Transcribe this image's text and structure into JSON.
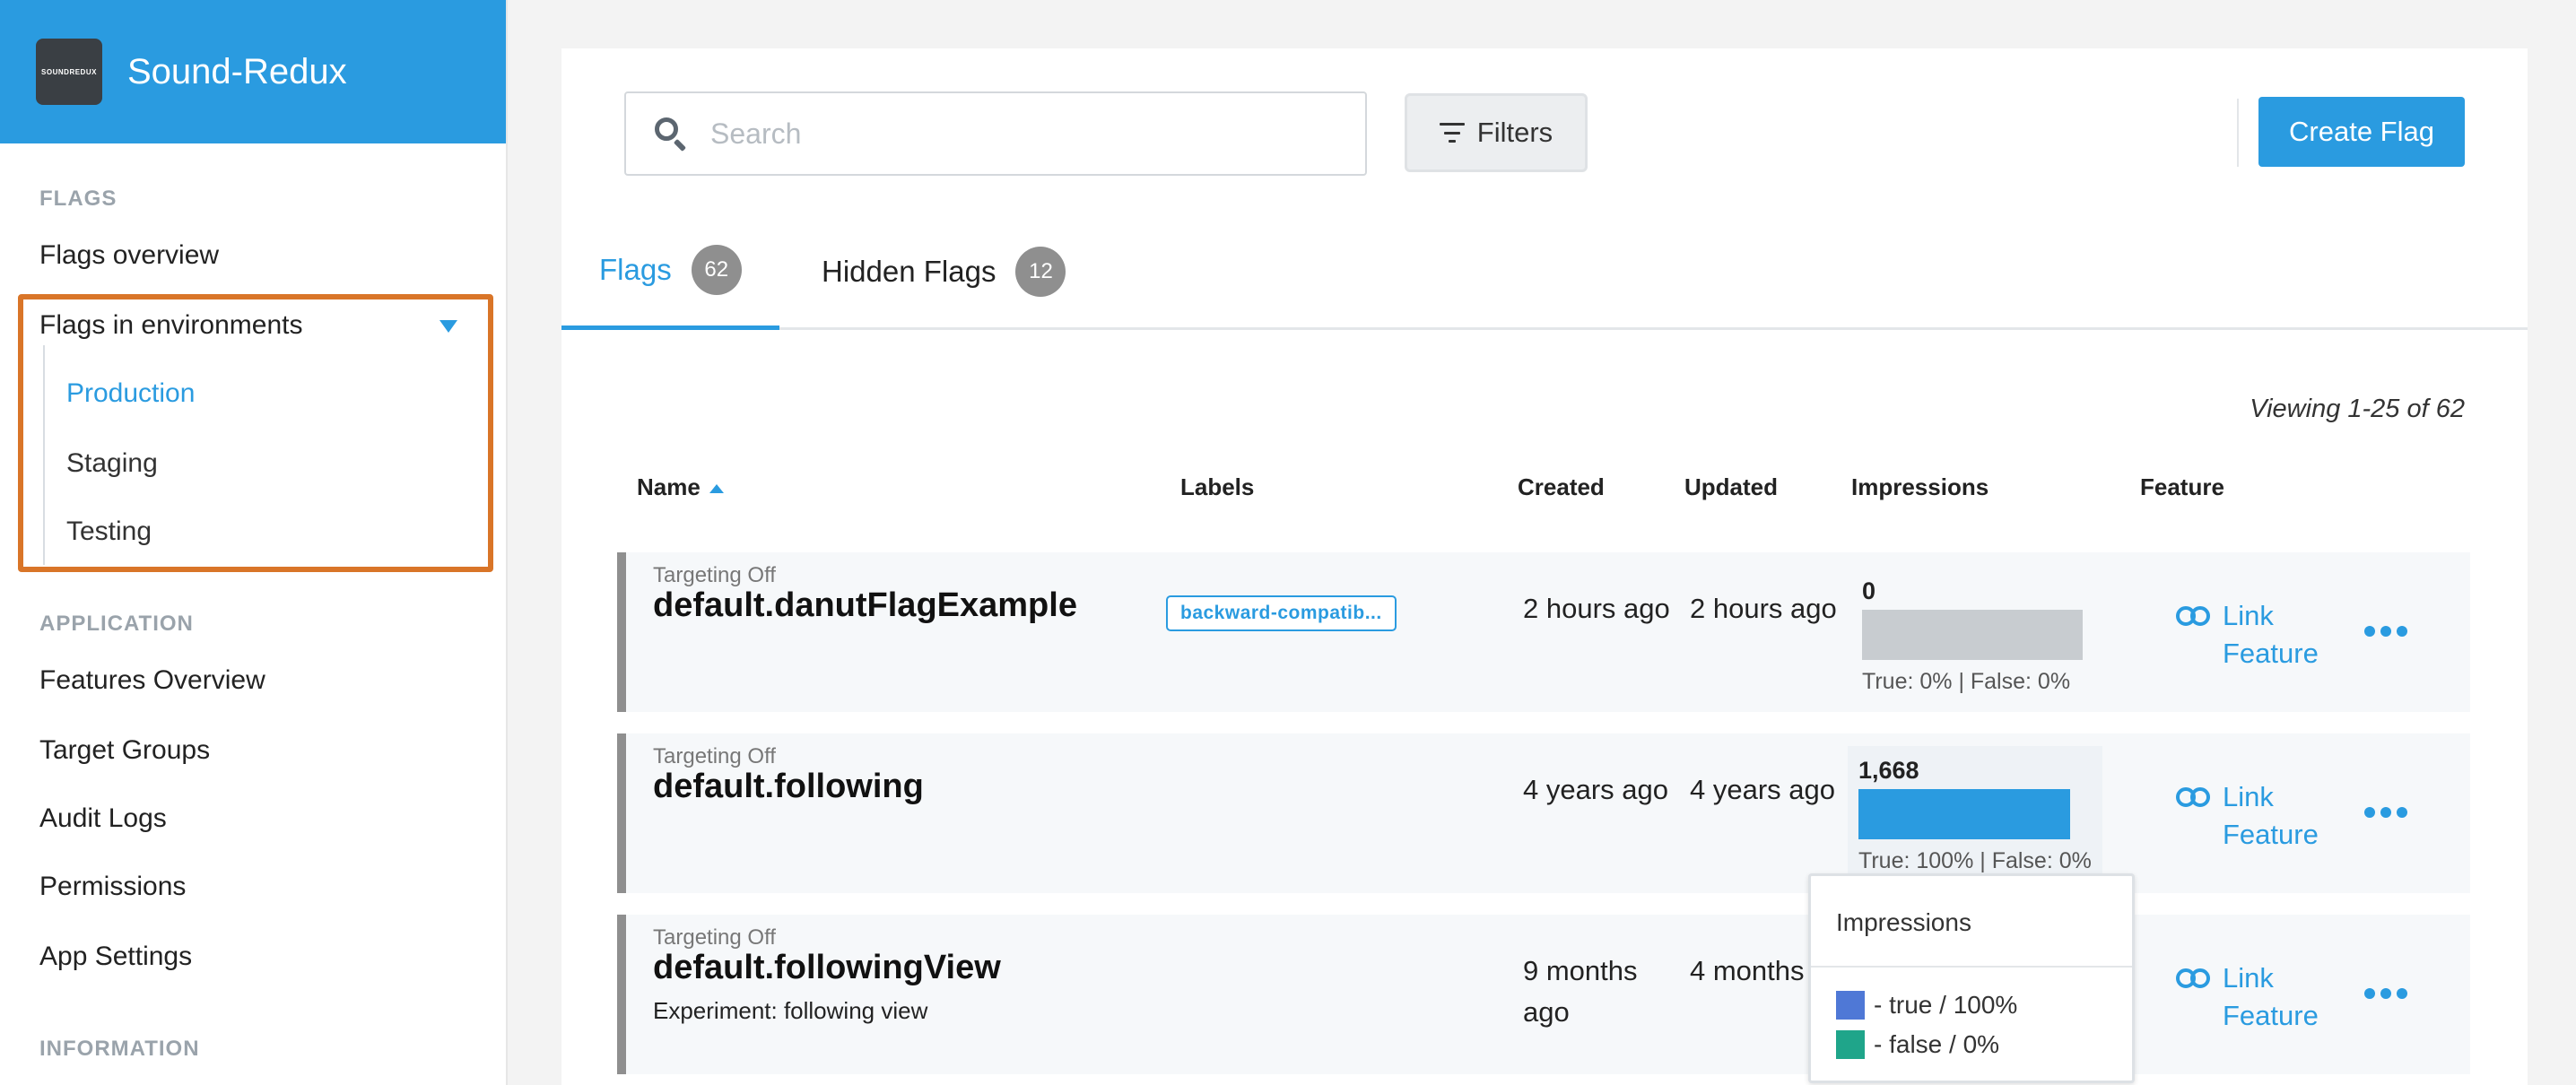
{
  "brand": {
    "logo_text": "SOUNDREDUX",
    "name": "Sound-Redux"
  },
  "sidebar": {
    "flags_label": "FLAGS",
    "flags_overview": "Flags overview",
    "flags_in_env": "Flags in environments",
    "environments": [
      "Production",
      "Staging",
      "Testing"
    ],
    "application_label": "APPLICATION",
    "app_items": [
      "Features Overview",
      "Target Groups",
      "Audit Logs",
      "Permissions",
      "App Settings"
    ],
    "information_label": "INFORMATION"
  },
  "search": {
    "placeholder": "Search"
  },
  "toolbar": {
    "filters_label": "Filters",
    "create_label": "Create Flag"
  },
  "tabs": [
    {
      "label": "Flags",
      "count": "62"
    },
    {
      "label": "Hidden Flags",
      "count": "12"
    }
  ],
  "viewing": "Viewing 1-25 of 62",
  "table": {
    "headers": {
      "name": "Name",
      "labels": "Labels",
      "created": "Created",
      "updated": "Updated",
      "impressions": "Impressions",
      "feature": "Feature"
    },
    "rows": [
      {
        "status": "Targeting Off",
        "name": "default.danutFlagExample",
        "description": "",
        "label": "backward-compatib...",
        "created": "2 hours ago",
        "updated": "2 hours ago",
        "impressions": "0",
        "impressions_true_fraction": 0,
        "impressions_sub": "True: 0% | False: 0%",
        "feature": "Link Feature"
      },
      {
        "status": "Targeting Off",
        "name": "default.following",
        "description": "",
        "label": "",
        "created": "4 years ago",
        "updated": "4 years ago",
        "impressions": "1,668",
        "impressions_true_fraction": 1,
        "impressions_sub": "True: 100% | False: 0%",
        "feature": "Link Feature"
      },
      {
        "status": "Targeting Off",
        "name": "default.followingView",
        "description": "Experiment: following view",
        "label": "",
        "created": "9 months ago",
        "updated": "4 months",
        "impressions": "",
        "impressions_sub": "",
        "feature": "Link Feature"
      }
    ]
  },
  "tooltip": {
    "title": "Impressions",
    "items": [
      {
        "label": "- true / 100%",
        "color": "#4f78d6"
      },
      {
        "label": "- false / 0%",
        "color": "#1fa58a"
      }
    ]
  },
  "colors": {
    "accent": "#2a9be0",
    "highlight": "#d97528",
    "empty_bar": "#c8ccd0"
  }
}
